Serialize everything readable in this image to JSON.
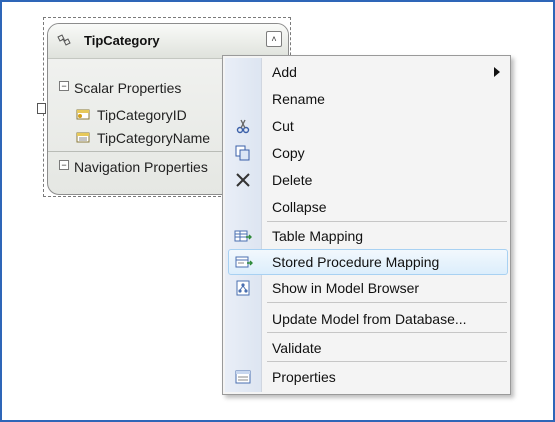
{
  "entity": {
    "title": "TipCategory",
    "collapse_glyph": "˄",
    "scalar_section": {
      "toggle": "−",
      "label": "Scalar Properties"
    },
    "properties": [
      {
        "name": "TipCategoryID",
        "icon": "key-property-icon"
      },
      {
        "name": "TipCategoryName",
        "icon": "scalar-property-icon"
      }
    ],
    "navigation_section": {
      "toggle": "−",
      "label": "Navigation Properties"
    }
  },
  "context_menu": {
    "items": [
      {
        "label": "Add",
        "icon": "",
        "submenu": true
      },
      {
        "label": "Rename",
        "icon": ""
      },
      {
        "label": "Cut",
        "icon": "scissors-icon"
      },
      {
        "label": "Copy",
        "icon": "copy-icon"
      },
      {
        "label": "Delete",
        "icon": "delete-x-icon"
      },
      {
        "label": "Collapse",
        "icon": ""
      },
      {
        "label": "Table Mapping",
        "icon": "table-mapping-icon"
      },
      {
        "label": "Stored Procedure Mapping",
        "icon": "stored-procedure-mapping-icon",
        "highlighted": true
      },
      {
        "label": "Show in Model Browser",
        "icon": "model-browser-icon"
      },
      {
        "label": "Update Model from Database...",
        "icon": ""
      },
      {
        "label": "Validate",
        "icon": ""
      },
      {
        "label": "Properties",
        "icon": "properties-icon"
      }
    ]
  },
  "colors": {
    "frame_border": "#2e66b8",
    "highlight_border": "#a8d1f2",
    "highlight_fill": "#dceefc"
  }
}
